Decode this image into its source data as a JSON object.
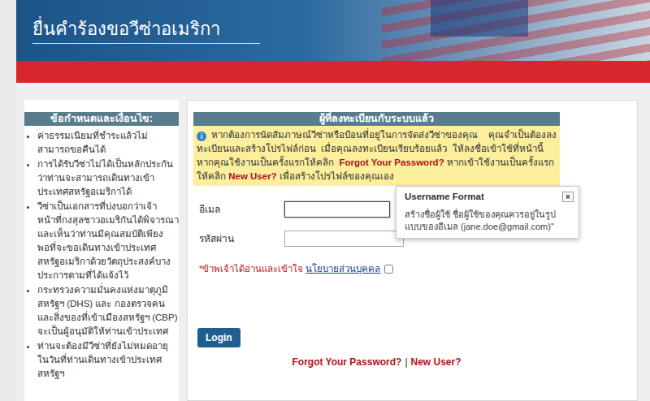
{
  "header": {
    "title": "ยื่นคำร้องขอวีซ่าอเมริกา"
  },
  "sidebar": {
    "title": "ข้อกำหนดและเงื่อนไข:",
    "items": [
      "ค่าธรรมเนียมที่ชำระแล้วไม่สามารถขอคืนได้",
      "การได้รับวีซ่าไม่ได้เป็นหลักประกันว่าท่านจะสามารถเดินทางเข้าประเทศสหรัฐอเมริกาได้",
      "วีซ่าเป็นเอกสารที่บ่งบอกว่าเจ้าหน้าที่กงสุลชาวอเมริกันได้พิจารณาและเห็นว่าท่านมีคุณสมบัติเพียงพอที่จะขอเดินทางเข้าประเทศสหรัฐอเมริกาด้วยวัตถุประสงค์บางประการตามที่ได้แจ้งไว้",
      "กระทรวงความมั่นคงแห่งมาตุภูมิสหรัฐฯ (DHS) และ กองตรวจคนและสิ่งของที่เข้าเมืองสหรัฐฯ (CBP) จะเป็นผู้อนุมัติให้ท่านเข้าประเทศ",
      "ท่านจะต้องมีวีซ่าที่ยังไม่หมดอายุในวันที่ท่านเดินทางเข้าประเทศสหรัฐฯ"
    ]
  },
  "panel": {
    "title": "ผู้ที่ลงทะเบียนกับระบบแล้ว",
    "info": {
      "icon": "i",
      "segments": [
        {
          "kind": "text",
          "text": "หากต้องการนัดสัมภาษณ์วีซ่าหรือป้อนที่อยู่ในการจัดส่งวีซ่าของคุณ    คุณจำเป็นต้องลงทะเบียนและสร้างโปรไฟล์ก่อน  เมื่อคุณลงทะเบียนเรียบร้อยแล้ว  ให้ลงชื่อเข้าใช้ที่หน้านี้  หากคุณใช้งานเป็นครั้งแรกให้คลิก  "
        },
        {
          "kind": "link",
          "text": "Forgot Your Password?"
        },
        {
          "kind": "text",
          "text": " หากเข้าใช้งานเป็นครั้งแรก ให้คลิก "
        },
        {
          "kind": "link",
          "text": "New User?"
        },
        {
          "kind": "text",
          "text": " เพื่อสร้างโปรไฟล์ของคุณเอง"
        }
      ]
    },
    "email": {
      "label": "อีเมล",
      "value": "",
      "focused": true
    },
    "password": {
      "label": "รหัสผ่าน",
      "value": ""
    },
    "consent": {
      "text": "*ข้าพเจ้าได้อ่านและเข้าใจ",
      "link": "นโยบายส่วนบุคคล",
      "checked": false
    },
    "login_button": "Login",
    "links": [
      "Forgot Your Password?",
      "New User?"
    ],
    "separator": "|"
  },
  "tooltip": {
    "title": "Username Format",
    "close": "×",
    "body": "สร้างชื่อผู้ใช้ ชื่อผู้ใช้ของคุณควรอยู่ในรูปแบบของอีเมล (jane.doe@gmail.com)\""
  }
}
